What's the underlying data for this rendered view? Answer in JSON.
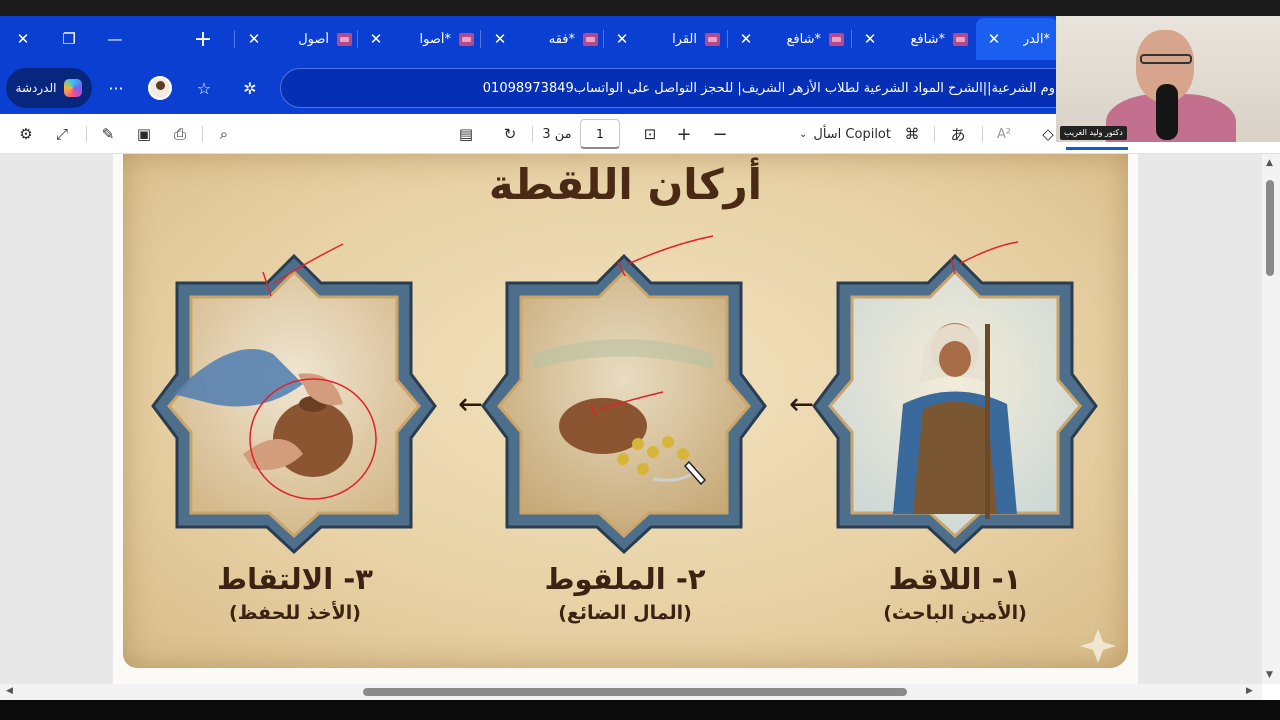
{
  "window": {
    "close_label": "✕",
    "restore_label": "❐",
    "minimize_label": "—",
    "new_tab_label": "+"
  },
  "tabs": [
    {
      "title": "*الدر",
      "active": true
    },
    {
      "title": "*شافع",
      "active": false
    },
    {
      "title": "*شافع",
      "active": false
    },
    {
      "title": "القرا",
      "active": false
    },
    {
      "title": "*فقه",
      "active": false
    },
    {
      "title": "*أصوا",
      "active": false
    },
    {
      "title": "أصول",
      "active": false
    }
  ],
  "addressbar": {
    "chat_label": "الدردشة",
    "more_label": "···",
    "url_text": "وم الشرعية||الشرح المواد الشرعية لطلاب الأزهر الشريف| للحجز التواصل على الواتساب01098973849"
  },
  "pdf_toolbar": {
    "page_current": "1",
    "page_total": "من 3",
    "copilot_label": "اسأل Copilot",
    "translate_label": "あ",
    "read_aloud_label": "A²"
  },
  "document": {
    "title": "أركان اللقطة",
    "panels": [
      {
        "caption": "١- اللاقط",
        "sub": "(الأمين الباحث)"
      },
      {
        "caption": "٢- الملقوط",
        "sub": "(المال الضائع)"
      },
      {
        "caption": "٣- الالتقاط",
        "sub": "(الأخذ للحفظ)"
      }
    ],
    "arrow_glyph": "←"
  },
  "webcam": {
    "label": "دكتور وليد الغريب"
  },
  "colors": {
    "tabstrip": "#0b3fd1",
    "parchment": "#e8d2a6",
    "frame": "#4a6b8a",
    "ink": "#3b2212",
    "annotation": "#e0222a"
  }
}
